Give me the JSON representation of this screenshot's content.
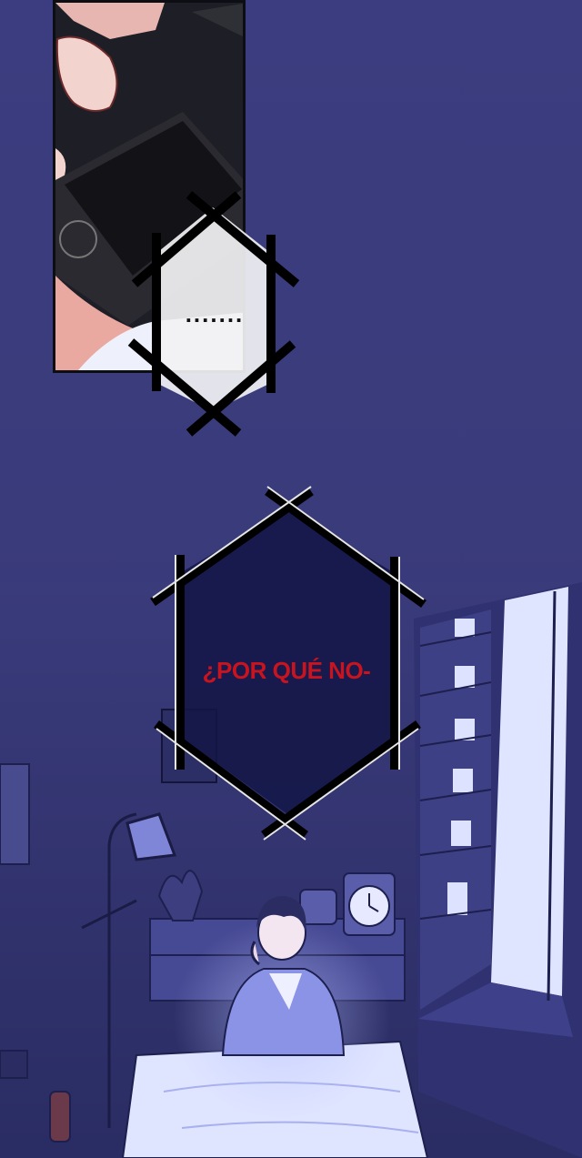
{
  "panels": {
    "top_panel": "phone close-up",
    "bottom_panel": "bedroom night scene"
  },
  "bubbles": {
    "first_text": ".......",
    "second_text": "¿POR QUÉ NO-"
  },
  "colors": {
    "background": "#3a3b7c",
    "bubble_fill_light": "#f2f2f4",
    "bubble_fill_dark": "#131545",
    "bubble_outline": "#000000",
    "accent_text": "#c8141e",
    "window_light": "#dfe4ff"
  }
}
